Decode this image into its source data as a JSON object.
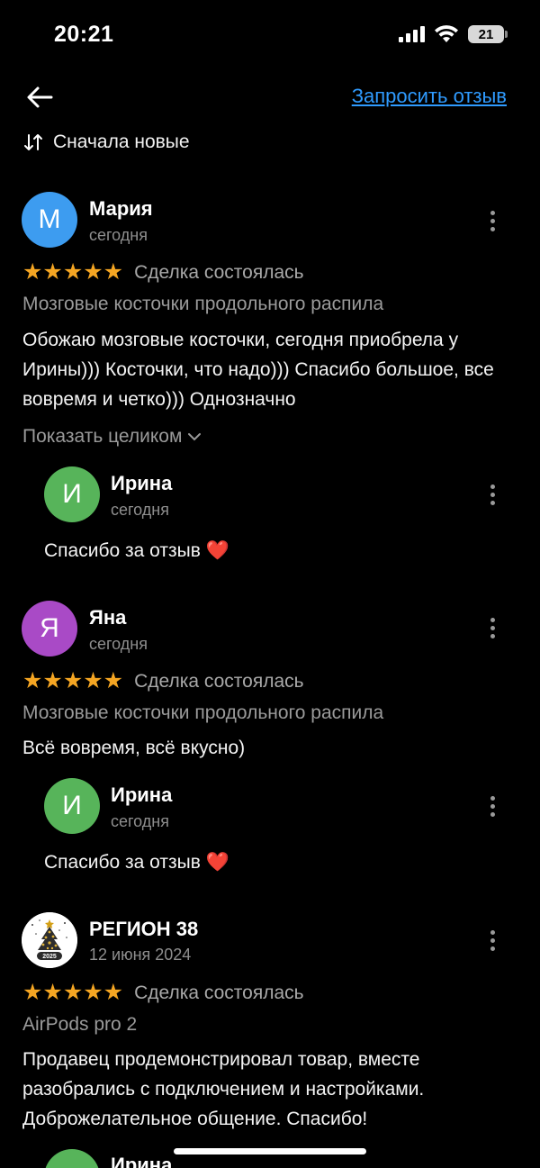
{
  "status": {
    "time": "20:21",
    "battery": "21"
  },
  "header": {
    "request_review": "Запросить отзыв"
  },
  "sort": {
    "label": "Сначала новые"
  },
  "reviews": [
    {
      "initial": "М",
      "avatar_color": "#3d9cf0",
      "name": "Мария",
      "date": "сегодня",
      "stars": "★★★★★",
      "status": "Сделка состоялась",
      "product": "Мозговые косточки продольного распила",
      "text": "Обожаю мозговые косточки, сегодня приобрела у Ирины))) Косточки, что надо))) Спасибо большое, все вовремя и четко))) Однозначно",
      "show_full": "Показать целиком",
      "reply": {
        "initial": "И",
        "avatar_color": "#57b45a",
        "name": "Ирина",
        "date": "сегодня",
        "text": "Спасибо за отзыв ❤️"
      }
    },
    {
      "initial": "Я",
      "avatar_color": "#a94ac6",
      "name": "Яна",
      "date": "сегодня",
      "stars": "★★★★★",
      "status": "Сделка состоялась",
      "product": "Мозговые косточки продольного распила",
      "text": "Всё вовремя, всё вкусно)",
      "reply": {
        "initial": "И",
        "avatar_color": "#57b45a",
        "name": "Ирина",
        "date": "сегодня",
        "text": "Спасибо за отзыв ❤️"
      }
    },
    {
      "avatar_badge": "2025",
      "name": "РЕГИОН 38",
      "date": "12 июня 2024",
      "stars": "★★★★★",
      "status": "Сделка состоялась",
      "product": "AirPods pro 2",
      "text": "Продавец продемонстрировал товар, вместе разобрались с подключением и настройками. Доброжелательное общение. Спасибо!",
      "reply": {
        "name": "Ирина"
      }
    }
  ]
}
